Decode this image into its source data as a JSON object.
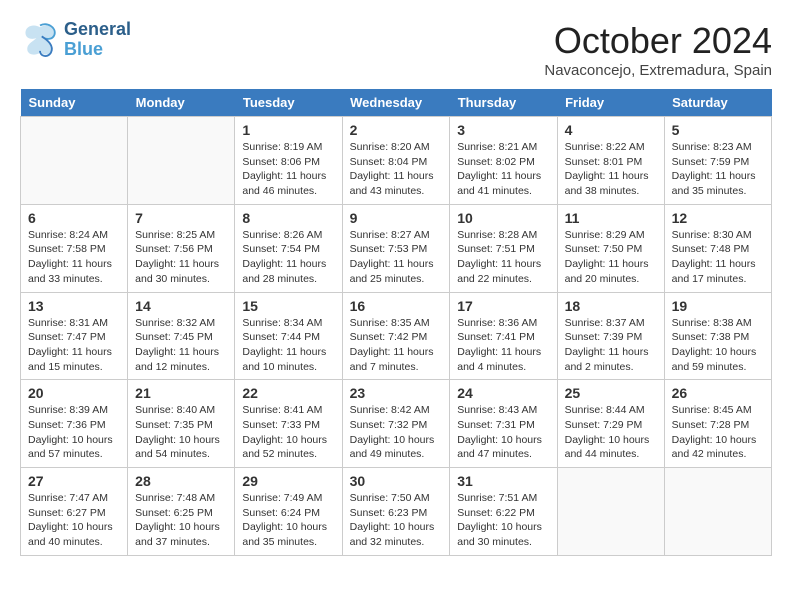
{
  "header": {
    "logo_general": "General",
    "logo_blue": "Blue",
    "month_title": "October 2024",
    "subtitle": "Navaconcejo, Extremadura, Spain"
  },
  "days_of_week": [
    "Sunday",
    "Monday",
    "Tuesday",
    "Wednesday",
    "Thursday",
    "Friday",
    "Saturday"
  ],
  "weeks": [
    [
      {
        "day": "",
        "info": ""
      },
      {
        "day": "",
        "info": ""
      },
      {
        "day": "1",
        "info": "Sunrise: 8:19 AM\nSunset: 8:06 PM\nDaylight: 11 hours and 46 minutes."
      },
      {
        "day": "2",
        "info": "Sunrise: 8:20 AM\nSunset: 8:04 PM\nDaylight: 11 hours and 43 minutes."
      },
      {
        "day": "3",
        "info": "Sunrise: 8:21 AM\nSunset: 8:02 PM\nDaylight: 11 hours and 41 minutes."
      },
      {
        "day": "4",
        "info": "Sunrise: 8:22 AM\nSunset: 8:01 PM\nDaylight: 11 hours and 38 minutes."
      },
      {
        "day": "5",
        "info": "Sunrise: 8:23 AM\nSunset: 7:59 PM\nDaylight: 11 hours and 35 minutes."
      }
    ],
    [
      {
        "day": "6",
        "info": "Sunrise: 8:24 AM\nSunset: 7:58 PM\nDaylight: 11 hours and 33 minutes."
      },
      {
        "day": "7",
        "info": "Sunrise: 8:25 AM\nSunset: 7:56 PM\nDaylight: 11 hours and 30 minutes."
      },
      {
        "day": "8",
        "info": "Sunrise: 8:26 AM\nSunset: 7:54 PM\nDaylight: 11 hours and 28 minutes."
      },
      {
        "day": "9",
        "info": "Sunrise: 8:27 AM\nSunset: 7:53 PM\nDaylight: 11 hours and 25 minutes."
      },
      {
        "day": "10",
        "info": "Sunrise: 8:28 AM\nSunset: 7:51 PM\nDaylight: 11 hours and 22 minutes."
      },
      {
        "day": "11",
        "info": "Sunrise: 8:29 AM\nSunset: 7:50 PM\nDaylight: 11 hours and 20 minutes."
      },
      {
        "day": "12",
        "info": "Sunrise: 8:30 AM\nSunset: 7:48 PM\nDaylight: 11 hours and 17 minutes."
      }
    ],
    [
      {
        "day": "13",
        "info": "Sunrise: 8:31 AM\nSunset: 7:47 PM\nDaylight: 11 hours and 15 minutes."
      },
      {
        "day": "14",
        "info": "Sunrise: 8:32 AM\nSunset: 7:45 PM\nDaylight: 11 hours and 12 minutes."
      },
      {
        "day": "15",
        "info": "Sunrise: 8:34 AM\nSunset: 7:44 PM\nDaylight: 11 hours and 10 minutes."
      },
      {
        "day": "16",
        "info": "Sunrise: 8:35 AM\nSunset: 7:42 PM\nDaylight: 11 hours and 7 minutes."
      },
      {
        "day": "17",
        "info": "Sunrise: 8:36 AM\nSunset: 7:41 PM\nDaylight: 11 hours and 4 minutes."
      },
      {
        "day": "18",
        "info": "Sunrise: 8:37 AM\nSunset: 7:39 PM\nDaylight: 11 hours and 2 minutes."
      },
      {
        "day": "19",
        "info": "Sunrise: 8:38 AM\nSunset: 7:38 PM\nDaylight: 10 hours and 59 minutes."
      }
    ],
    [
      {
        "day": "20",
        "info": "Sunrise: 8:39 AM\nSunset: 7:36 PM\nDaylight: 10 hours and 57 minutes."
      },
      {
        "day": "21",
        "info": "Sunrise: 8:40 AM\nSunset: 7:35 PM\nDaylight: 10 hours and 54 minutes."
      },
      {
        "day": "22",
        "info": "Sunrise: 8:41 AM\nSunset: 7:33 PM\nDaylight: 10 hours and 52 minutes."
      },
      {
        "day": "23",
        "info": "Sunrise: 8:42 AM\nSunset: 7:32 PM\nDaylight: 10 hours and 49 minutes."
      },
      {
        "day": "24",
        "info": "Sunrise: 8:43 AM\nSunset: 7:31 PM\nDaylight: 10 hours and 47 minutes."
      },
      {
        "day": "25",
        "info": "Sunrise: 8:44 AM\nSunset: 7:29 PM\nDaylight: 10 hours and 44 minutes."
      },
      {
        "day": "26",
        "info": "Sunrise: 8:45 AM\nSunset: 7:28 PM\nDaylight: 10 hours and 42 minutes."
      }
    ],
    [
      {
        "day": "27",
        "info": "Sunrise: 7:47 AM\nSunset: 6:27 PM\nDaylight: 10 hours and 40 minutes."
      },
      {
        "day": "28",
        "info": "Sunrise: 7:48 AM\nSunset: 6:25 PM\nDaylight: 10 hours and 37 minutes."
      },
      {
        "day": "29",
        "info": "Sunrise: 7:49 AM\nSunset: 6:24 PM\nDaylight: 10 hours and 35 minutes."
      },
      {
        "day": "30",
        "info": "Sunrise: 7:50 AM\nSunset: 6:23 PM\nDaylight: 10 hours and 32 minutes."
      },
      {
        "day": "31",
        "info": "Sunrise: 7:51 AM\nSunset: 6:22 PM\nDaylight: 10 hours and 30 minutes."
      },
      {
        "day": "",
        "info": ""
      },
      {
        "day": "",
        "info": ""
      }
    ]
  ]
}
